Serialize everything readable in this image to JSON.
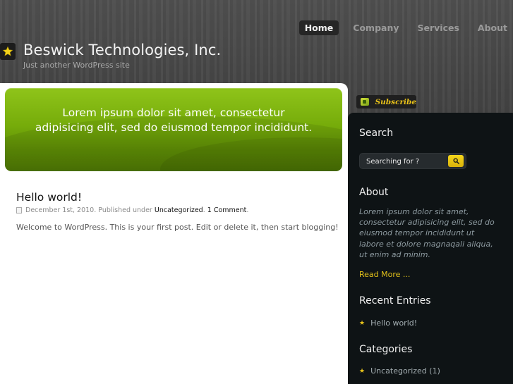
{
  "nav": {
    "items": [
      "Home",
      "Company",
      "Services",
      "About"
    ],
    "active": "Home"
  },
  "site": {
    "title": "Beswick Technologies, Inc.",
    "tagline": "Just another WordPress site"
  },
  "hero": {
    "text": "Lorem ipsum dolor sit amet, consectetur adipisicing elit, sed do eiusmod tempor incididunt."
  },
  "post": {
    "title": "Hello world!",
    "date": "December 1st, 2010. Published under",
    "category": "Uncategorized",
    "comments": "1 Comment",
    "body": "Welcome to WordPress. This is your first post. Edit or delete it, then start blogging!"
  },
  "subscribe": {
    "label": "Subscribe"
  },
  "sidebar": {
    "search_heading": "Search",
    "search_placeholder": "Searching for ?",
    "about_heading": "About",
    "about_text": "Lorem ipsum dolor sit amet, consectetur adipisicing elit, sed do eiusmod tempor incididunt ut labore et dolore magnaqali aliqua, ut enim ad minim.",
    "read_more": "Read More ...",
    "recent_heading": "Recent Entries",
    "recent_items": [
      "Hello world!"
    ],
    "categories_heading": "Categories",
    "categories_items": [
      "Uncategorized (1)"
    ]
  },
  "colors": {
    "accent_green": "#76ac0a",
    "accent_yellow": "#e3c21a",
    "sidebar_bg": "#0e1315"
  }
}
